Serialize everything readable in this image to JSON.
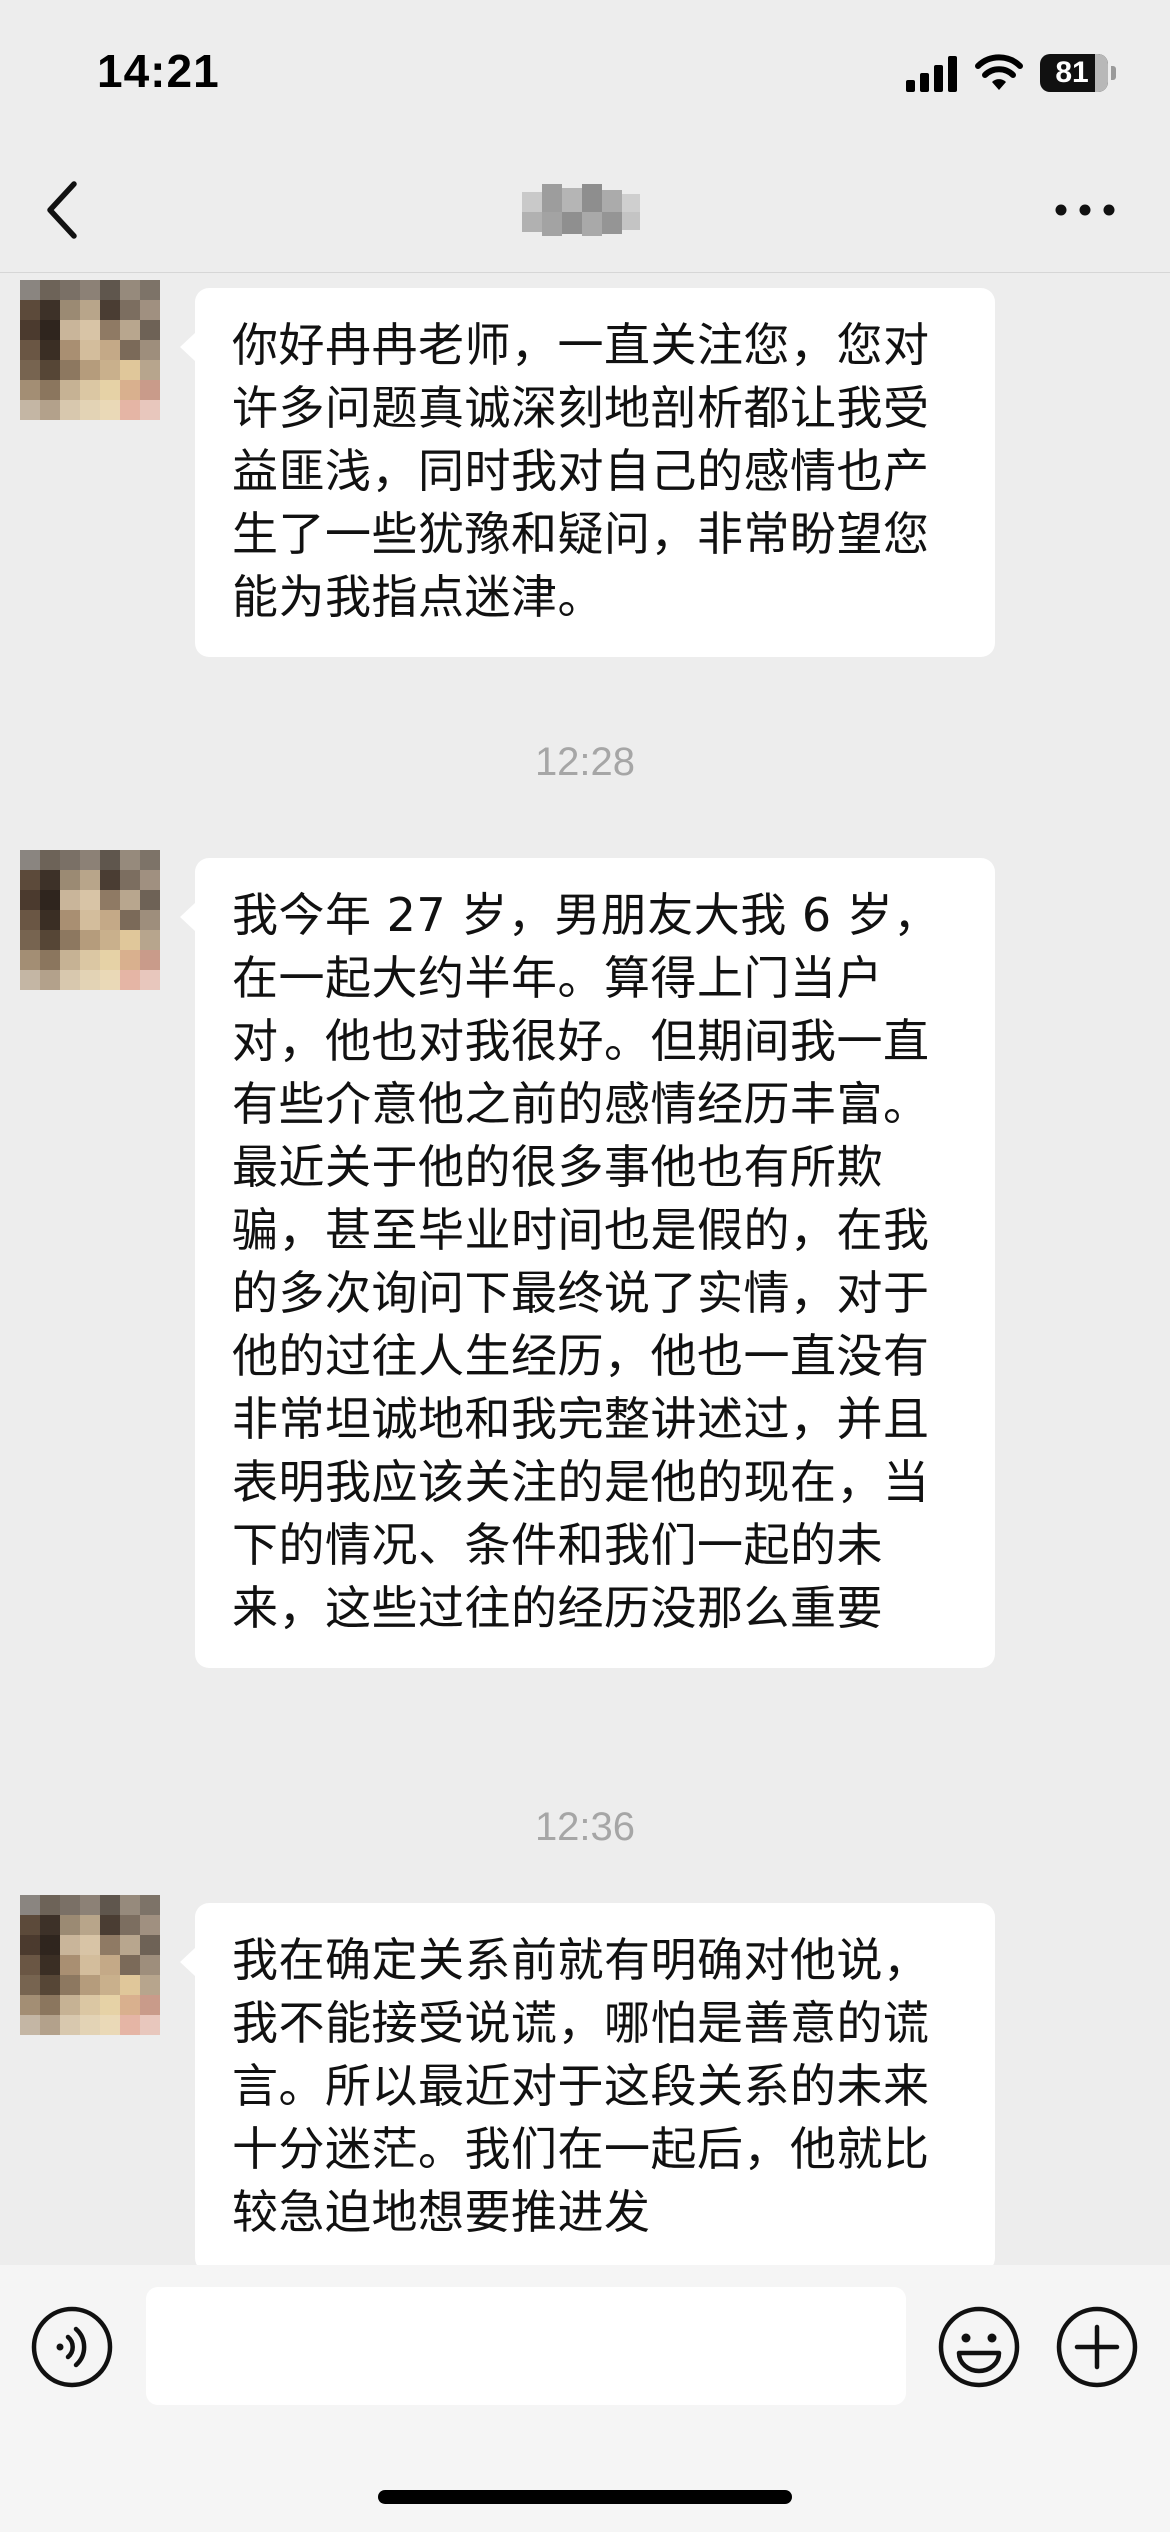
{
  "status_bar": {
    "time": "14:21",
    "battery_level": "81",
    "icons": [
      "signal-icon",
      "wifi-icon",
      "battery-icon"
    ]
  },
  "nav": {
    "title": "",
    "title_blurred": true,
    "icons": [
      "back-chevron-icon",
      "more-dots-icon"
    ]
  },
  "messages": [
    {
      "type": "incoming",
      "avatar_blurred": true,
      "text": "你好冉冉老师，一直关注您，您对许多问题真诚深刻地剖析都让我受益匪浅，同时我对自己的感情也产生了一些犹豫和疑问，非常盼望您能为我指点迷津。"
    },
    {
      "type": "timestamp",
      "text": "12:28"
    },
    {
      "type": "incoming",
      "avatar_blurred": true,
      "text": "我今年 27 岁，男朋友大我 6 岁，在一起大约半年。算得上门当户对，他也对我很好。但期间我一直有些介意他之前的感情经历丰富。最近关于他的很多事他也有所欺骗，甚至毕业时间也是假的，在我的多次询问下最终说了实情，对于他的过往人生经历，他也一直没有非常坦诚地和我完整讲述过，并且表明我应该关注的是他的现在，当下的情况、条件和我们一起的未来，这些过往的经历没那么重要"
    },
    {
      "type": "timestamp",
      "text": "12:36"
    },
    {
      "type": "incoming",
      "avatar_blurred": true,
      "text": "我在确定关系前就有明确对他说，我不能接受说谎，哪怕是善意的谎言。所以最近对于这段关系的未来十分迷茫。我们在一起后，他就比较急迫地想要推进发"
    }
  ],
  "input_bar": {
    "placeholder": "",
    "value": "",
    "icons": [
      "voice-icon",
      "emoji-icon",
      "plus-icon"
    ]
  },
  "colors": {
    "background": "#ededed",
    "bubble": "#ffffff",
    "timestamp_text": "#a6a6a6",
    "input_bar": "#f5f5f5"
  }
}
